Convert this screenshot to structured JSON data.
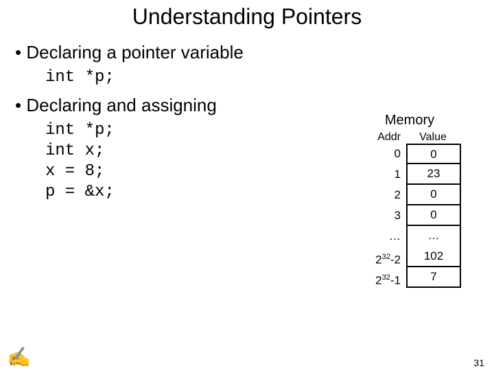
{
  "title": "Understanding Pointers",
  "bullet1": "Declaring a pointer variable",
  "code1": "int *p;",
  "bullet2": "Declaring and assigning",
  "code2": "int *p;\nint x;\nx = 8;\np = &x;",
  "memory": {
    "title": "Memory",
    "headers": {
      "addr": "Addr",
      "value": "Value"
    },
    "rows": [
      {
        "addr": "0",
        "value": "0"
      },
      {
        "addr": "1",
        "value": "23"
      },
      {
        "addr": "2",
        "value": "0"
      },
      {
        "addr": "3",
        "value": "0"
      },
      {
        "addr": "…",
        "value": "…"
      }
    ],
    "row_2n2": {
      "addr_base": "2",
      "addr_exp": "32",
      "addr_suffix": "-2",
      "value": "102"
    },
    "row_2n1": {
      "addr_base": "2",
      "addr_exp": "32",
      "addr_suffix": "-1",
      "value": "7"
    }
  },
  "slide_number": "31",
  "chart_data": {
    "type": "table",
    "title": "Memory",
    "columns": [
      "Addr",
      "Value"
    ],
    "rows": [
      [
        "0",
        0
      ],
      [
        "1",
        23
      ],
      [
        "2",
        0
      ],
      [
        "3",
        0
      ],
      [
        "…",
        "…"
      ],
      [
        "2^32-2",
        102
      ],
      [
        "2^32-1",
        7
      ]
    ]
  }
}
